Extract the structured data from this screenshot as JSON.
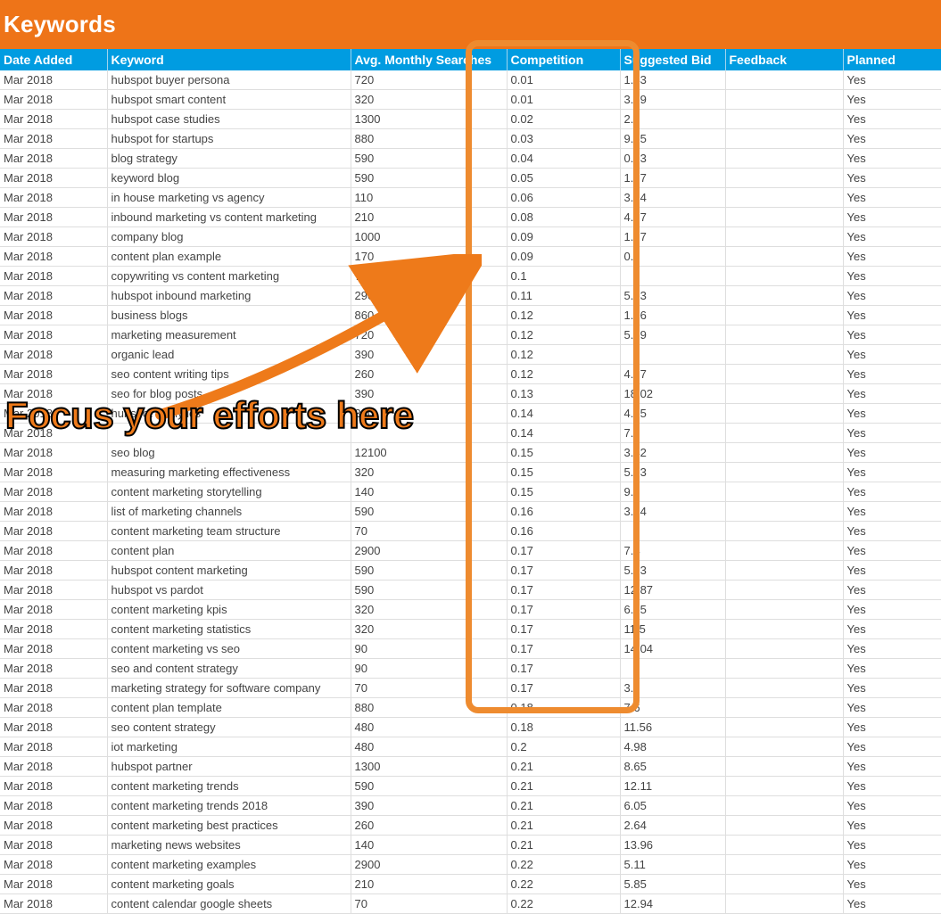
{
  "page_title": "Keywords",
  "headers": {
    "date_added": "Date Added",
    "keyword": "Keyword",
    "avg_monthly_searches": "Avg. Monthly Searches",
    "competition": "Competition",
    "suggested_bid": "Suggested Bid",
    "feedback": "Feedback",
    "planned": "Planned"
  },
  "annotation": {
    "caption": "Focus your efforts here"
  },
  "rows": [
    {
      "date": "Mar 2018",
      "keyword": "hubspot buyer persona",
      "searches": "720",
      "competition": "0.01",
      "bid": "1.43",
      "feedback": "",
      "planned": "Yes"
    },
    {
      "date": "Mar 2018",
      "keyword": "hubspot smart content",
      "searches": "320",
      "competition": "0.01",
      "bid": "3.69",
      "feedback": "",
      "planned": "Yes"
    },
    {
      "date": "Mar 2018",
      "keyword": "hubspot case studies",
      "searches": "1300",
      "competition": "0.02",
      "bid": "2.7",
      "feedback": "",
      "planned": "Yes"
    },
    {
      "date": "Mar 2018",
      "keyword": "hubspot for startups",
      "searches": "880",
      "competition": "0.03",
      "bid": "9.65",
      "feedback": "",
      "planned": "Yes"
    },
    {
      "date": "Mar 2018",
      "keyword": "blog strategy",
      "searches": "590",
      "competition": "0.04",
      "bid": "0.53",
      "feedback": "",
      "planned": "Yes"
    },
    {
      "date": "Mar 2018",
      "keyword": "keyword blog",
      "searches": "590",
      "competition": "0.05",
      "bid": "1.77",
      "feedback": "",
      "planned": "Yes"
    },
    {
      "date": "Mar 2018",
      "keyword": "in house marketing vs agency",
      "searches": "110",
      "competition": "0.06",
      "bid": "3.64",
      "feedback": "",
      "planned": "Yes"
    },
    {
      "date": "Mar 2018",
      "keyword": "inbound marketing vs content marketing",
      "searches": "210",
      "competition": "0.08",
      "bid": "4.67",
      "feedback": "",
      "planned": "Yes"
    },
    {
      "date": "Mar 2018",
      "keyword": "company blog",
      "searches": "1000",
      "competition": "0.09",
      "bid": "1.77",
      "feedback": "",
      "planned": "Yes"
    },
    {
      "date": "Mar 2018",
      "keyword": "content plan example",
      "searches": "170",
      "competition": "0.09",
      "bid": "0.6",
      "feedback": "",
      "planned": "Yes"
    },
    {
      "date": "Mar 2018",
      "keyword": "copywriting vs content marketing",
      "searches": "70",
      "competition": "0.1",
      "bid": "",
      "feedback": "",
      "planned": "Yes"
    },
    {
      "date": "Mar 2018",
      "keyword": "hubspot inbound marketing",
      "searches": "2900",
      "competition": "0.11",
      "bid": "5.53",
      "feedback": "",
      "planned": "Yes"
    },
    {
      "date": "Mar 2018",
      "keyword": "business blogs",
      "searches": "860",
      "competition": "0.12",
      "bid": "1.06",
      "feedback": "",
      "planned": "Yes"
    },
    {
      "date": "Mar 2018",
      "keyword": "marketing measurement",
      "searches": "720",
      "competition": "0.12",
      "bid": "5.99",
      "feedback": "",
      "planned": "Yes"
    },
    {
      "date": "Mar 2018",
      "keyword": "organic lead",
      "searches": "390",
      "competition": "0.12",
      "bid": "",
      "feedback": "",
      "planned": "Yes"
    },
    {
      "date": "Mar 2018",
      "keyword": "seo content writing tips",
      "searches": "260",
      "competition": "0.12",
      "bid": "4.37",
      "feedback": "",
      "planned": "Yes"
    },
    {
      "date": "Mar 2018",
      "keyword": "seo for blog posts",
      "searches": "390",
      "competition": "0.13",
      "bid": "18.02",
      "feedback": "",
      "planned": "Yes"
    },
    {
      "date": "Mar 2018",
      "keyword": "hubspot analytics",
      "searches": "390",
      "competition": "0.14",
      "bid": "4.25",
      "feedback": "",
      "planned": "Yes"
    },
    {
      "date": "Mar 2018",
      "keyword": "",
      "searches": "",
      "competition": "0.14",
      "bid": "7.2",
      "feedback": "",
      "planned": "Yes"
    },
    {
      "date": "Mar 2018",
      "keyword": "seo blog",
      "searches": "12100",
      "competition": "0.15",
      "bid": "3.42",
      "feedback": "",
      "planned": "Yes"
    },
    {
      "date": "Mar 2018",
      "keyword": "measuring marketing effectiveness",
      "searches": "320",
      "competition": "0.15",
      "bid": "5.83",
      "feedback": "",
      "planned": "Yes"
    },
    {
      "date": "Mar 2018",
      "keyword": "content marketing storytelling",
      "searches": "140",
      "competition": "0.15",
      "bid": "9.8",
      "feedback": "",
      "planned": "Yes"
    },
    {
      "date": "Mar 2018",
      "keyword": "list of marketing channels",
      "searches": "590",
      "competition": "0.16",
      "bid": "3.94",
      "feedback": "",
      "planned": "Yes"
    },
    {
      "date": "Mar 2018",
      "keyword": "content marketing team structure",
      "searches": "70",
      "competition": "0.16",
      "bid": "",
      "feedback": "",
      "planned": "Yes"
    },
    {
      "date": "Mar 2018",
      "keyword": "content plan",
      "searches": "2900",
      "competition": "0.17",
      "bid": "7.4",
      "feedback": "",
      "planned": "Yes"
    },
    {
      "date": "Mar 2018",
      "keyword": "hubspot content marketing",
      "searches": "590",
      "competition": "0.17",
      "bid": "5.93",
      "feedback": "",
      "planned": "Yes"
    },
    {
      "date": "Mar 2018",
      "keyword": "hubspot vs pardot",
      "searches": "590",
      "competition": "0.17",
      "bid": "12.87",
      "feedback": "",
      "planned": "Yes"
    },
    {
      "date": "Mar 2018",
      "keyword": "content marketing kpis",
      "searches": "320",
      "competition": "0.17",
      "bid": "6.15",
      "feedback": "",
      "planned": "Yes"
    },
    {
      "date": "Mar 2018",
      "keyword": "content marketing statistics",
      "searches": "320",
      "competition": "0.17",
      "bid": "11.5",
      "feedback": "",
      "planned": "Yes"
    },
    {
      "date": "Mar 2018",
      "keyword": "content marketing vs seo",
      "searches": "90",
      "competition": "0.17",
      "bid": "14.04",
      "feedback": "",
      "planned": "Yes"
    },
    {
      "date": "Mar 2018",
      "keyword": "seo and content strategy",
      "searches": "90",
      "competition": "0.17",
      "bid": "",
      "feedback": "",
      "planned": "Yes"
    },
    {
      "date": "Mar 2018",
      "keyword": "marketing strategy for software company",
      "searches": "70",
      "competition": "0.17",
      "bid": "3.9",
      "feedback": "",
      "planned": "Yes"
    },
    {
      "date": "Mar 2018",
      "keyword": "content plan template",
      "searches": "880",
      "competition": "0.18",
      "bid": "7.6",
      "feedback": "",
      "planned": "Yes"
    },
    {
      "date": "Mar 2018",
      "keyword": "seo content strategy",
      "searches": "480",
      "competition": "0.18",
      "bid": "11.56",
      "feedback": "",
      "planned": "Yes"
    },
    {
      "date": "Mar 2018",
      "keyword": "iot marketing",
      "searches": "480",
      "competition": "0.2",
      "bid": "4.98",
      "feedback": "",
      "planned": "Yes"
    },
    {
      "date": "Mar 2018",
      "keyword": "hubspot partner",
      "searches": "1300",
      "competition": "0.21",
      "bid": "8.65",
      "feedback": "",
      "planned": "Yes"
    },
    {
      "date": "Mar 2018",
      "keyword": "content marketing trends",
      "searches": "590",
      "competition": "0.21",
      "bid": "12.11",
      "feedback": "",
      "planned": "Yes"
    },
    {
      "date": "Mar 2018",
      "keyword": "content marketing trends 2018",
      "searches": "390",
      "competition": "0.21",
      "bid": "6.05",
      "feedback": "",
      "planned": "Yes"
    },
    {
      "date": "Mar 2018",
      "keyword": "content marketing best practices",
      "searches": "260",
      "competition": "0.21",
      "bid": "2.64",
      "feedback": "",
      "planned": "Yes"
    },
    {
      "date": "Mar 2018",
      "keyword": "marketing news websites",
      "searches": "140",
      "competition": "0.21",
      "bid": "13.96",
      "feedback": "",
      "planned": "Yes"
    },
    {
      "date": "Mar 2018",
      "keyword": "content marketing examples",
      "searches": "2900",
      "competition": "0.22",
      "bid": "5.11",
      "feedback": "",
      "planned": "Yes"
    },
    {
      "date": "Mar 2018",
      "keyword": "content marketing goals",
      "searches": "210",
      "competition": "0.22",
      "bid": "5.85",
      "feedback": "",
      "planned": "Yes"
    },
    {
      "date": "Mar 2018",
      "keyword": "content calendar google sheets",
      "searches": "70",
      "competition": "0.22",
      "bid": "12.94",
      "feedback": "",
      "planned": "Yes"
    }
  ]
}
